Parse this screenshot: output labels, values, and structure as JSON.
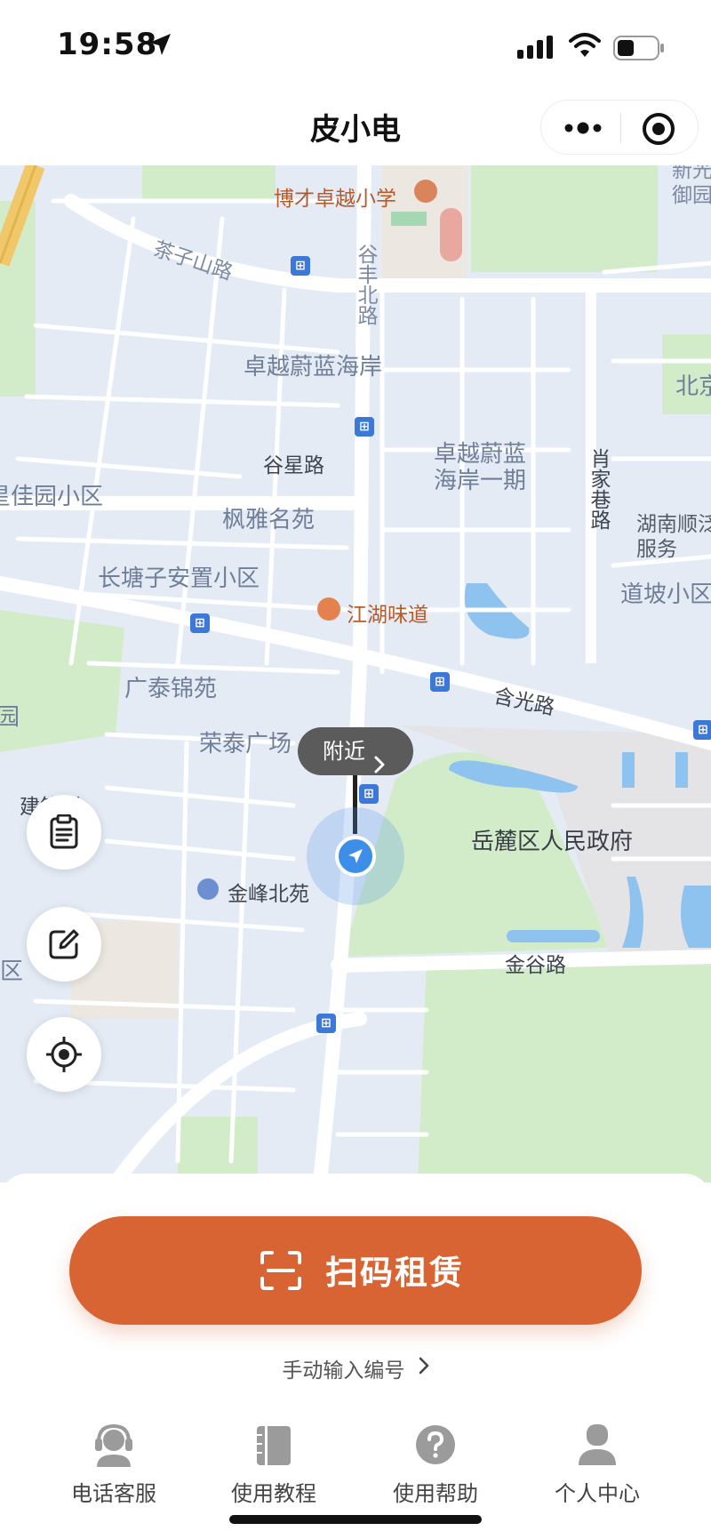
{
  "status_bar": {
    "time": "19:58"
  },
  "nav": {
    "title": "皮小电"
  },
  "map": {
    "labels": {
      "school": "博才卓越小学",
      "chazishan": "茶子山路",
      "gufeng": "谷丰北路",
      "zhuoyue": "卓越蔚蓝海岸",
      "guxing": "谷星路",
      "phase1": "卓越蔚蓝\n海岸一期",
      "xiaojia": "肖家巷路",
      "jiayuan": "星佳园小区",
      "fengya": "枫雅名苑",
      "changtang": "长塘子安置小区",
      "jianghu": "江湖味道",
      "hunan": "湖南顺泛\n服务",
      "daopo": "道坡小区",
      "guangtai": "广泰锦苑",
      "hanguang": "含光路",
      "rongtai": "荣泰广场",
      "jianzhu": "建筑群",
      "government": "岳麓区人民政府",
      "jinfeng": "金峰北苑",
      "jingu": "金谷路",
      "xinguang": "新光\n御园",
      "beijing": "北京",
      "qu": "区",
      "yuan": "园"
    },
    "nearby_label": "附近"
  },
  "actions": {
    "scan_label": "扫码租赁",
    "manual_label": "手动输入编号"
  },
  "tabs": [
    {
      "label": "电话客服",
      "icon": "headset-icon"
    },
    {
      "label": "使用教程",
      "icon": "book-icon"
    },
    {
      "label": "使用帮助",
      "icon": "help-icon"
    },
    {
      "label": "个人中心",
      "icon": "person-icon"
    }
  ],
  "colors": {
    "accent": "#d96433",
    "map_bg": "#e4ebf5",
    "park": "#d2ecc9",
    "bus": "#3b78d8"
  }
}
